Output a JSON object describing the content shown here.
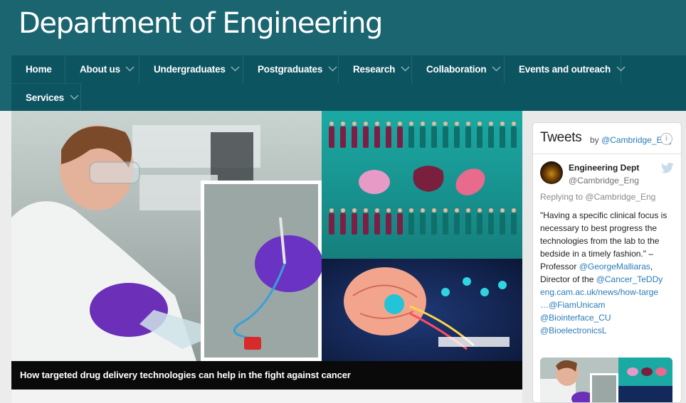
{
  "site": {
    "title": "Department of Engineering"
  },
  "nav": {
    "items": [
      {
        "label": "Home",
        "has_dropdown": false
      },
      {
        "label": "About us",
        "has_dropdown": true
      },
      {
        "label": "Undergraduates",
        "has_dropdown": true
      },
      {
        "label": "Postgraduates",
        "has_dropdown": true
      },
      {
        "label": "Research",
        "has_dropdown": true
      },
      {
        "label": "Collaboration",
        "has_dropdown": true
      },
      {
        "label": "Events and outreach",
        "has_dropdown": true
      },
      {
        "label": "Services",
        "has_dropdown": true
      }
    ]
  },
  "hero": {
    "caption": "How targeted drug delivery technologies can help in the fight against cancer"
  },
  "tweets": {
    "title": "Tweets",
    "by_prefix": "by",
    "by_handle": "@Cambridge_Eng",
    "tweet": {
      "author_name": "Engineering Dept",
      "author_handle": "@Cambridge_Eng",
      "reply_prefix": "Replying to",
      "reply_handle": "@Cambridge_Eng",
      "lines": [
        "\"Having a specific clinical focus is",
        "necessary to best progress the",
        "technologies from the lab to the",
        "bedside in a timely fashion.\" –"
      ],
      "prof_prefix": "Professor ",
      "prof_link": "@GeorgeMalliaras",
      "prof_suffix": ",",
      "director_prefix": "Director of the ",
      "director_link": "@Cancer_TeDDy",
      "url": "eng.cam.ac.uk/news/how-targe",
      "mention_1": "…@FiamUnicam",
      "mention_2": "@Biointerface_CU",
      "mention_3": "@BioelectronicsL"
    }
  },
  "colors": {
    "header": "#1b6571",
    "nav": "#0d5461",
    "link": "#2b7bb9"
  },
  "icons": {
    "nav_dropdown": "chevron-down-icon",
    "twitter": "twitter-bird-icon",
    "info": "info-icon"
  }
}
